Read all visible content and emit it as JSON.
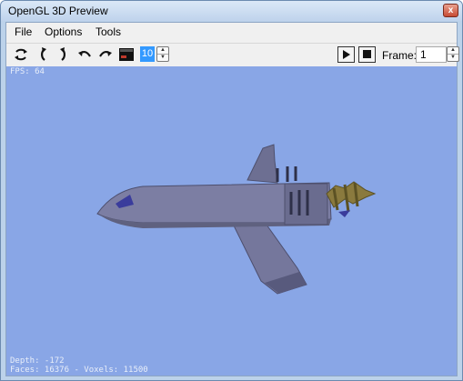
{
  "window": {
    "title": "OpenGL 3D Preview",
    "close_glyph": "x"
  },
  "menu": {
    "items": [
      "File",
      "Options",
      "Tools"
    ]
  },
  "toolbar": {
    "icons": [
      "rotate-icon",
      "turn-left-icon",
      "turn-right-icon",
      "undo-icon",
      "redo-icon",
      "screen-icon"
    ],
    "step_value": "10",
    "frame_label": "Frame:",
    "frame_value": "1"
  },
  "viewport": {
    "background": "#89a6e6",
    "fps": "FPS: 64",
    "depth": "Depth: -172",
    "stats": "Faces: 16376 - Voxels: 11500"
  }
}
